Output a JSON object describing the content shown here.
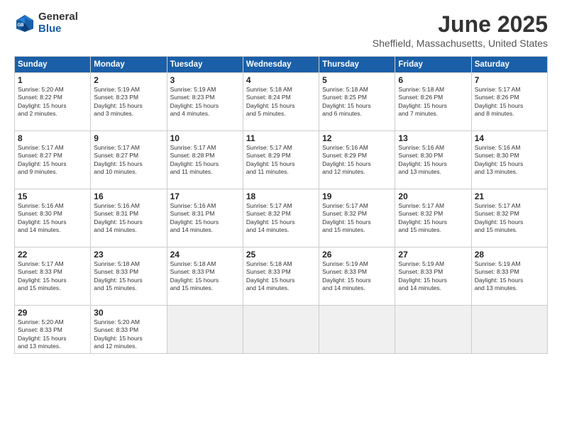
{
  "logo": {
    "general": "General",
    "blue": "Blue"
  },
  "title": "June 2025",
  "location": "Sheffield, Massachusetts, United States",
  "headers": [
    "Sunday",
    "Monday",
    "Tuesday",
    "Wednesday",
    "Thursday",
    "Friday",
    "Saturday"
  ],
  "weeks": [
    [
      {
        "day": "1",
        "info": "Sunrise: 5:20 AM\nSunset: 8:22 PM\nDaylight: 15 hours\nand 2 minutes."
      },
      {
        "day": "2",
        "info": "Sunrise: 5:19 AM\nSunset: 8:23 PM\nDaylight: 15 hours\nand 3 minutes."
      },
      {
        "day": "3",
        "info": "Sunrise: 5:19 AM\nSunset: 8:23 PM\nDaylight: 15 hours\nand 4 minutes."
      },
      {
        "day": "4",
        "info": "Sunrise: 5:18 AM\nSunset: 8:24 PM\nDaylight: 15 hours\nand 5 minutes."
      },
      {
        "day": "5",
        "info": "Sunrise: 5:18 AM\nSunset: 8:25 PM\nDaylight: 15 hours\nand 6 minutes."
      },
      {
        "day": "6",
        "info": "Sunrise: 5:18 AM\nSunset: 8:26 PM\nDaylight: 15 hours\nand 7 minutes."
      },
      {
        "day": "7",
        "info": "Sunrise: 5:17 AM\nSunset: 8:26 PM\nDaylight: 15 hours\nand 8 minutes."
      }
    ],
    [
      {
        "day": "8",
        "info": "Sunrise: 5:17 AM\nSunset: 8:27 PM\nDaylight: 15 hours\nand 9 minutes."
      },
      {
        "day": "9",
        "info": "Sunrise: 5:17 AM\nSunset: 8:27 PM\nDaylight: 15 hours\nand 10 minutes."
      },
      {
        "day": "10",
        "info": "Sunrise: 5:17 AM\nSunset: 8:28 PM\nDaylight: 15 hours\nand 11 minutes."
      },
      {
        "day": "11",
        "info": "Sunrise: 5:17 AM\nSunset: 8:29 PM\nDaylight: 15 hours\nand 11 minutes."
      },
      {
        "day": "12",
        "info": "Sunrise: 5:16 AM\nSunset: 8:29 PM\nDaylight: 15 hours\nand 12 minutes."
      },
      {
        "day": "13",
        "info": "Sunrise: 5:16 AM\nSunset: 8:30 PM\nDaylight: 15 hours\nand 13 minutes."
      },
      {
        "day": "14",
        "info": "Sunrise: 5:16 AM\nSunset: 8:30 PM\nDaylight: 15 hours\nand 13 minutes."
      }
    ],
    [
      {
        "day": "15",
        "info": "Sunrise: 5:16 AM\nSunset: 8:30 PM\nDaylight: 15 hours\nand 14 minutes."
      },
      {
        "day": "16",
        "info": "Sunrise: 5:16 AM\nSunset: 8:31 PM\nDaylight: 15 hours\nand 14 minutes."
      },
      {
        "day": "17",
        "info": "Sunrise: 5:16 AM\nSunset: 8:31 PM\nDaylight: 15 hours\nand 14 minutes."
      },
      {
        "day": "18",
        "info": "Sunrise: 5:17 AM\nSunset: 8:32 PM\nDaylight: 15 hours\nand 14 minutes."
      },
      {
        "day": "19",
        "info": "Sunrise: 5:17 AM\nSunset: 8:32 PM\nDaylight: 15 hours\nand 15 minutes."
      },
      {
        "day": "20",
        "info": "Sunrise: 5:17 AM\nSunset: 8:32 PM\nDaylight: 15 hours\nand 15 minutes."
      },
      {
        "day": "21",
        "info": "Sunrise: 5:17 AM\nSunset: 8:32 PM\nDaylight: 15 hours\nand 15 minutes."
      }
    ],
    [
      {
        "day": "22",
        "info": "Sunrise: 5:17 AM\nSunset: 8:33 PM\nDaylight: 15 hours\nand 15 minutes."
      },
      {
        "day": "23",
        "info": "Sunrise: 5:18 AM\nSunset: 8:33 PM\nDaylight: 15 hours\nand 15 minutes."
      },
      {
        "day": "24",
        "info": "Sunrise: 5:18 AM\nSunset: 8:33 PM\nDaylight: 15 hours\nand 15 minutes."
      },
      {
        "day": "25",
        "info": "Sunrise: 5:18 AM\nSunset: 8:33 PM\nDaylight: 15 hours\nand 14 minutes."
      },
      {
        "day": "26",
        "info": "Sunrise: 5:19 AM\nSunset: 8:33 PM\nDaylight: 15 hours\nand 14 minutes."
      },
      {
        "day": "27",
        "info": "Sunrise: 5:19 AM\nSunset: 8:33 PM\nDaylight: 15 hours\nand 14 minutes."
      },
      {
        "day": "28",
        "info": "Sunrise: 5:19 AM\nSunset: 8:33 PM\nDaylight: 15 hours\nand 13 minutes."
      }
    ],
    [
      {
        "day": "29",
        "info": "Sunrise: 5:20 AM\nSunset: 8:33 PM\nDaylight: 15 hours\nand 13 minutes."
      },
      {
        "day": "30",
        "info": "Sunrise: 5:20 AM\nSunset: 8:33 PM\nDaylight: 15 hours\nand 12 minutes."
      },
      {
        "day": "",
        "info": ""
      },
      {
        "day": "",
        "info": ""
      },
      {
        "day": "",
        "info": ""
      },
      {
        "day": "",
        "info": ""
      },
      {
        "day": "",
        "info": ""
      }
    ]
  ]
}
